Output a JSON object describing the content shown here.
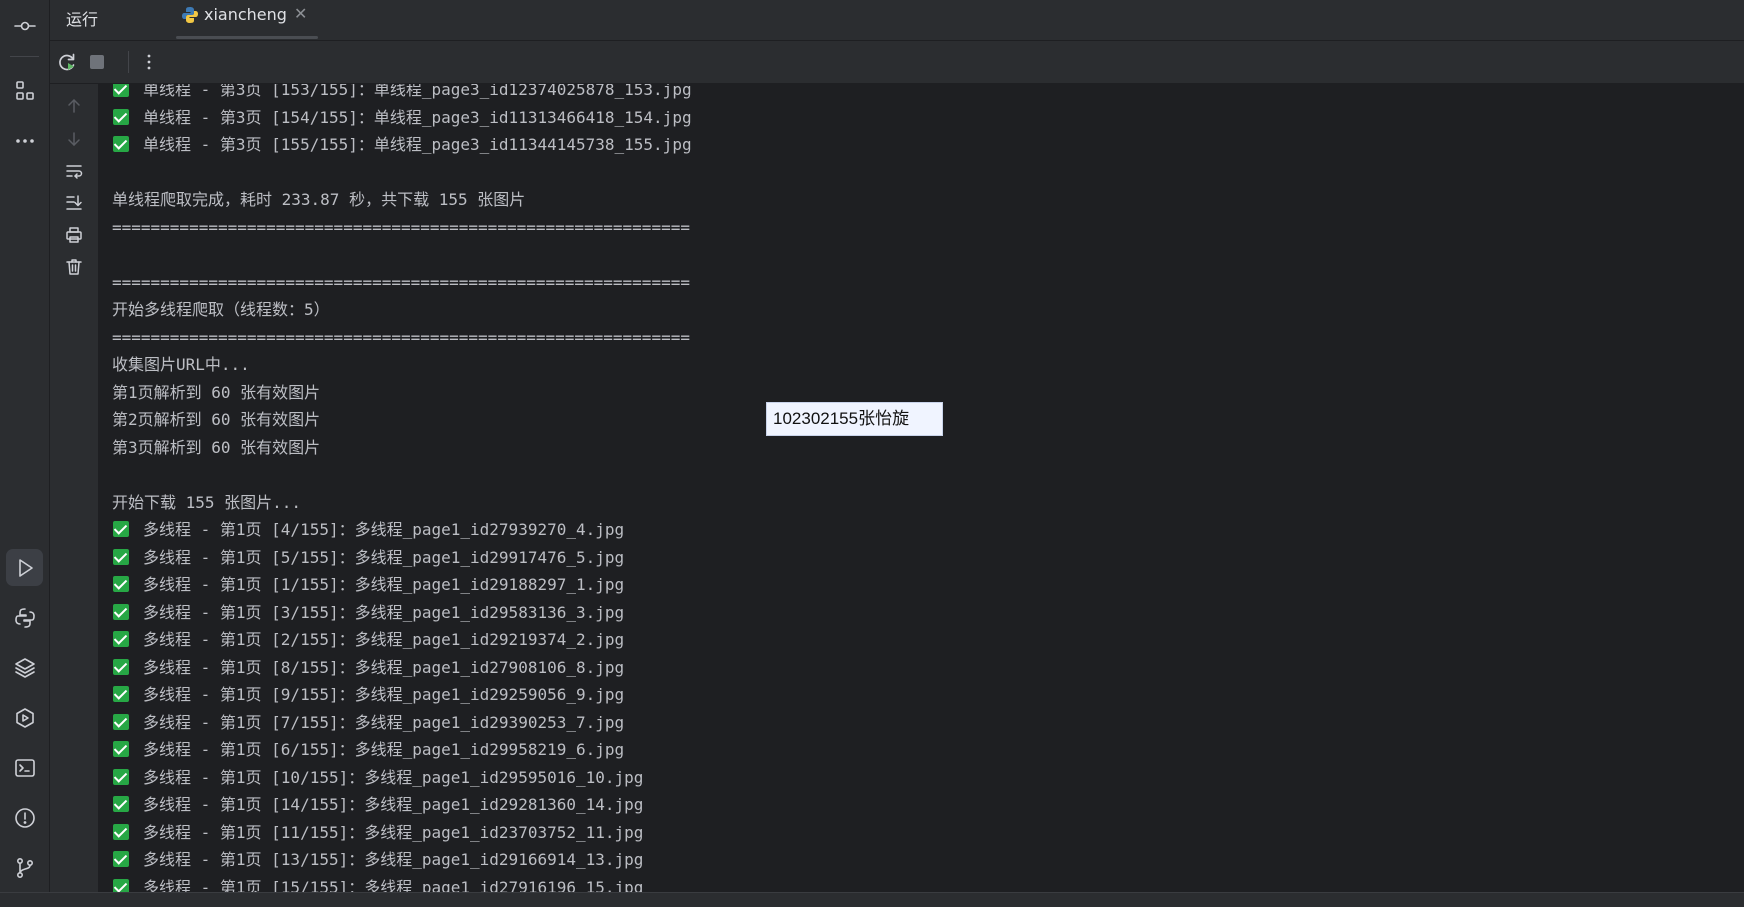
{
  "tabbar": {
    "run_label": "运行",
    "tab_name": "xiancheng"
  },
  "activity_bar": {
    "items": [
      {
        "name": "commit-icon"
      },
      {
        "name": "structure-icon"
      },
      {
        "name": "more-icon"
      },
      {
        "name": "run-icon",
        "active": true
      },
      {
        "name": "python-console-icon"
      },
      {
        "name": "layers-icon"
      },
      {
        "name": "services-icon"
      },
      {
        "name": "terminal-icon"
      },
      {
        "name": "problems-icon"
      },
      {
        "name": "git-icon"
      }
    ]
  },
  "console": {
    "lines": [
      {
        "check": true,
        "text": "单线程 - 第3页 [153/155]：单线程_page3_id12374025878_153.jpg"
      },
      {
        "check": true,
        "text": "单线程 - 第3页 [154/155]：单线程_page3_id11313466418_154.jpg"
      },
      {
        "check": true,
        "text": "单线程 - 第3页 [155/155]：单线程_page3_id11344145738_155.jpg"
      },
      {
        "check": false,
        "text": ""
      },
      {
        "check": false,
        "text": "单线程爬取完成，耗时 233.87 秒，共下载 155 张图片"
      },
      {
        "check": false,
        "text": "============================================================"
      },
      {
        "check": false,
        "text": ""
      },
      {
        "check": false,
        "text": "============================================================"
      },
      {
        "check": false,
        "text": "开始多线程爬取（线程数：5）"
      },
      {
        "check": false,
        "text": "============================================================"
      },
      {
        "check": false,
        "text": "收集图片URL中..."
      },
      {
        "check": false,
        "text": "第1页解析到 60 张有效图片"
      },
      {
        "check": false,
        "text": "第2页解析到 60 张有效图片"
      },
      {
        "check": false,
        "text": "第3页解析到 60 张有效图片"
      },
      {
        "check": false,
        "text": ""
      },
      {
        "check": false,
        "text": "开始下载 155 张图片..."
      },
      {
        "check": true,
        "text": "多线程 - 第1页 [4/155]：多线程_page1_id27939270_4.jpg"
      },
      {
        "check": true,
        "text": "多线程 - 第1页 [5/155]：多线程_page1_id29917476_5.jpg"
      },
      {
        "check": true,
        "text": "多线程 - 第1页 [1/155]：多线程_page1_id29188297_1.jpg"
      },
      {
        "check": true,
        "text": "多线程 - 第1页 [3/155]：多线程_page1_id29583136_3.jpg"
      },
      {
        "check": true,
        "text": "多线程 - 第1页 [2/155]：多线程_page1_id29219374_2.jpg"
      },
      {
        "check": true,
        "text": "多线程 - 第1页 [8/155]：多线程_page1_id27908106_8.jpg"
      },
      {
        "check": true,
        "text": "多线程 - 第1页 [9/155]：多线程_page1_id29259056_9.jpg"
      },
      {
        "check": true,
        "text": "多线程 - 第1页 [7/155]：多线程_page1_id29390253_7.jpg"
      },
      {
        "check": true,
        "text": "多线程 - 第1页 [6/155]：多线程_page1_id29958219_6.jpg"
      },
      {
        "check": true,
        "text": "多线程 - 第1页 [10/155]：多线程_page1_id29595016_10.jpg"
      },
      {
        "check": true,
        "text": "多线程 - 第1页 [14/155]：多线程_page1_id29281360_14.jpg"
      },
      {
        "check": true,
        "text": "多线程 - 第1页 [11/155]：多线程_page1_id23703752_11.jpg"
      },
      {
        "check": true,
        "text": "多线程 - 第1页 [13/155]：多线程_page1_id29166914_13.jpg"
      },
      {
        "check": true,
        "text": "多线程 - 第1页 [15/155]：多线程_page1_id27916196_15.jpg"
      }
    ]
  },
  "overlay": {
    "text": "102302155张怡旋"
  },
  "colors": {
    "background": "#1e1f22",
    "panel": "#2b2d30",
    "console_text": "#bcbec4",
    "check_green": "#27a745"
  }
}
